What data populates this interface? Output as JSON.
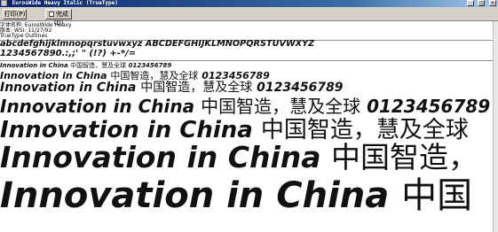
{
  "window": {
    "title": "EurosWide Heavy Italic (TrueType)",
    "controls": [
      "_",
      "□",
      "×"
    ]
  },
  "toolbar": {
    "print_label": "打印(P)",
    "done_label": "完成(D)"
  },
  "font_info": {
    "name_line": "字体名称: EurosWide Heavy",
    "version_line": "版本: WSI: 11/27/92",
    "type_line": "TrueType Outlines"
  },
  "charset": {
    "line1": "abcdefghijklmnopqrstuvwxyz ABCDEFGHIJKLMNOPQRSTUVWXYZ",
    "line2": "1234567890.:,;' \" (!?) +-*/="
  },
  "samples": [
    {
      "size": "12",
      "latin": "Innovation in China",
      "cjk": "中国智造，慧及全球",
      "digits": "0123456789"
    },
    {
      "size": "18",
      "latin": "Innovation in China",
      "cjk": "中国智造，慧及全球",
      "digits": "0123456789"
    },
    {
      "size": "24",
      "latin": "Innovation in China",
      "cjk": "中国智造，慧及全球",
      "digits": "0123456789"
    },
    {
      "size": "36",
      "latin": "Innovation in China",
      "cjk": "中国智造，慧及全球",
      "digits": "0123456789"
    },
    {
      "size": "48",
      "latin": "Innovation in China",
      "cjk": "中国智造，慧及全球",
      "digits": ""
    },
    {
      "size": "60",
      "latin": "Innovation in China",
      "cjk": "中国智造，",
      "digits": ""
    },
    {
      "size": "72",
      "latin": "Innovation in China",
      "cjk": "中国",
      "digits": ""
    }
  ]
}
